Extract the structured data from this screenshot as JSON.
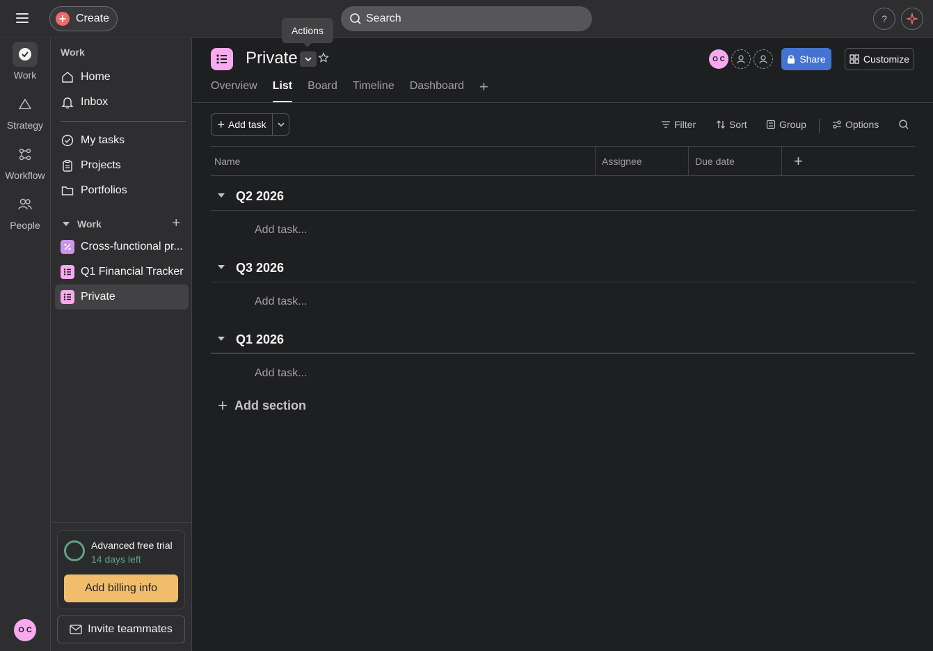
{
  "topbar": {
    "create_label": "Create",
    "search_label": "Search",
    "help_label": "?",
    "tooltip": "Actions"
  },
  "rail": {
    "items": [
      {
        "label": "Work",
        "icon": "check-circle-icon",
        "active": true
      },
      {
        "label": "Strategy",
        "icon": "triangle-icon"
      },
      {
        "label": "Workflow",
        "icon": "workflow-icon"
      },
      {
        "label": "People",
        "icon": "people-icon"
      }
    ],
    "avatar_initials": "O C"
  },
  "sidebar": {
    "heading": "Work",
    "nav": [
      {
        "label": "Home",
        "icon": "home-icon"
      },
      {
        "label": "Inbox",
        "icon": "bell-icon"
      }
    ],
    "nav2": [
      {
        "label": "My tasks",
        "icon": "check-circle-icon"
      },
      {
        "label": "Projects",
        "icon": "clipboard-icon"
      },
      {
        "label": "Portfolios",
        "icon": "folder-icon"
      }
    ],
    "group_label": "Work",
    "projects": [
      {
        "label": "Cross-functional pr...",
        "color": "#cd95ea"
      },
      {
        "label": "Q1 Financial Tracker",
        "color": "#f9aaef"
      },
      {
        "label": "Private",
        "color": "#f9aaef",
        "selected": true
      }
    ],
    "trial": {
      "title": "Advanced free trial",
      "subtitle": "14 days left",
      "billing_label": "Add billing info"
    },
    "invite_label": "Invite teammates"
  },
  "project": {
    "title": "Private",
    "share_label": "Share",
    "customize_label": "Customize",
    "avatar_initials": "O C",
    "tabs": [
      "Overview",
      "List",
      "Board",
      "Timeline",
      "Dashboard"
    ],
    "active_tab": "List"
  },
  "toolbar": {
    "add_task_label": "Add task",
    "filter_label": "Filter",
    "sort_label": "Sort",
    "group_label": "Group",
    "options_label": "Options"
  },
  "columns": [
    "Name",
    "Assignee",
    "Due date"
  ],
  "sections": [
    {
      "title": "Q2 2026",
      "add_task": "Add task..."
    },
    {
      "title": "Q3 2026",
      "add_task": "Add task..."
    },
    {
      "title": "Q1 2026",
      "add_task": "Add task..."
    }
  ],
  "add_section_label": "Add section",
  "colors": {
    "accent_blue": "#4573d2",
    "create_red": "#f06a6a",
    "billing_orange": "#f1bd6c",
    "trial_green": "#5da283"
  }
}
